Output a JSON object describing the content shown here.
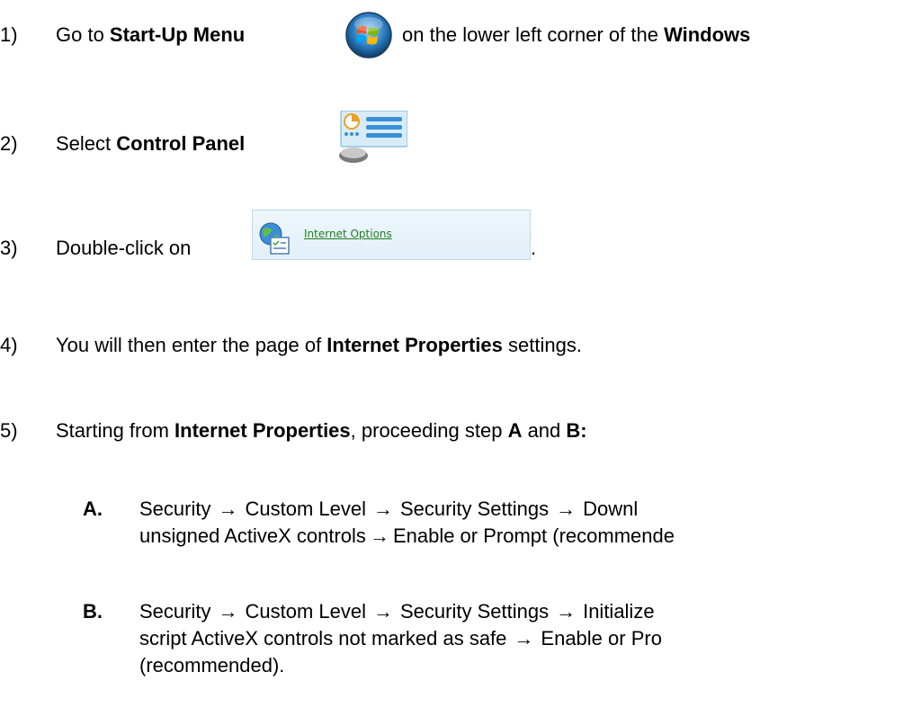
{
  "steps": [
    {
      "num": "1)",
      "text_a": "Go to ",
      "bold_a": "Start-Up Menu",
      "text_b": " on the lower left corner of the ",
      "bold_b": "Windows",
      "icon": "windows-start-orb-icon"
    },
    {
      "num": "2)",
      "text_a": "Select ",
      "bold_a": "Control Panel",
      "icon": "control-panel-icon"
    },
    {
      "num": "3)",
      "text_a": "Double-click on",
      "link_label": "Internet Options",
      "period": ".",
      "icon": "internet-options-globe-icon"
    },
    {
      "num": "4)",
      "text_a": "You will then enter the page of ",
      "bold_a": "Internet Properties",
      "text_b": " settings."
    },
    {
      "num": "5)",
      "text_a": "Starting from ",
      "bold_a": "Internet Properties",
      "text_b": ", proceeding step ",
      "bold_b": "A",
      "text_c": " and ",
      "bold_c": "B:"
    }
  ],
  "substeps": [
    {
      "letter": "A.",
      "line1_parts": [
        "Security",
        "Custom Level",
        "Security Settings",
        "Downl"
      ],
      "line2_parts": [
        "unsigned ActiveX controls",
        "Enable or Prompt (recommende"
      ]
    },
    {
      "letter": "B.",
      "line1_parts": [
        "Security",
        "Custom Level",
        "Security Settings",
        "Initialize"
      ],
      "line2_parts": [
        "script ActiveX controls not marked as safe",
        "Enable or Pro"
      ],
      "line3": "(recommended)."
    }
  ],
  "arrow": "→",
  "colors": {
    "text": "#000000",
    "link": "#1f7f1f",
    "io_box_bg": "#e2eff9",
    "io_box_border": "#bfd8ec"
  }
}
